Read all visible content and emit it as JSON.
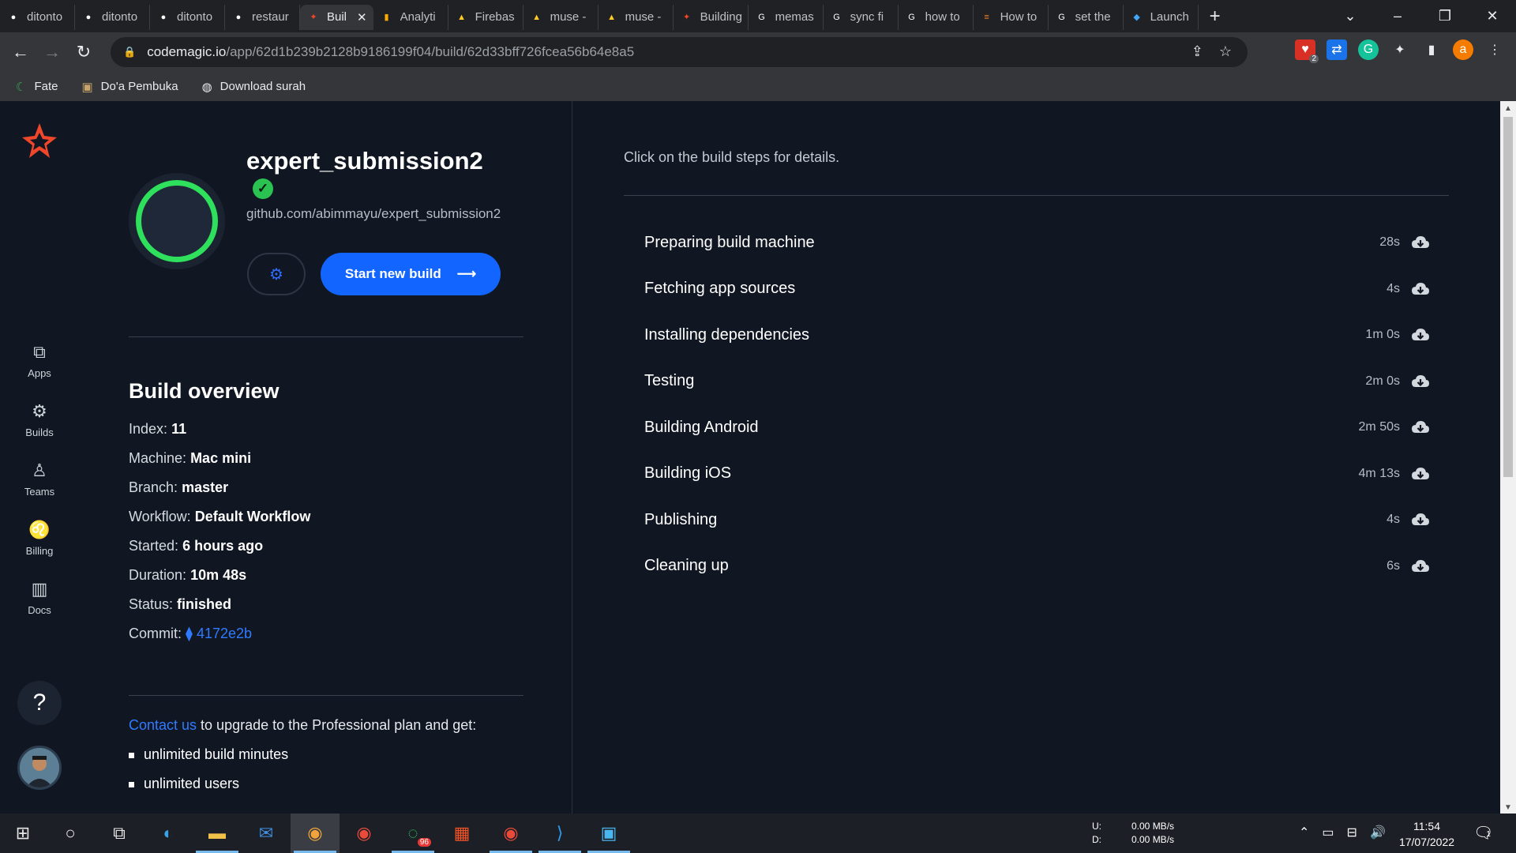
{
  "browser": {
    "tabs": [
      {
        "label": "ditonto",
        "icon": "github-icon"
      },
      {
        "label": "ditonto",
        "icon": "github-icon"
      },
      {
        "label": "ditonto",
        "icon": "github-icon"
      },
      {
        "label": "restaur",
        "icon": "github-icon"
      },
      {
        "label": "Buil",
        "icon": "codemagic-icon",
        "active": true
      },
      {
        "label": "Analyti",
        "icon": "analytics-icon"
      },
      {
        "label": "Firebas",
        "icon": "firebase-icon"
      },
      {
        "label": "muse -",
        "icon": "firebase-icon"
      },
      {
        "label": "muse -",
        "icon": "firebase-icon"
      },
      {
        "label": "Building",
        "icon": "codemagic-icon"
      },
      {
        "label": "memas",
        "icon": "google-icon"
      },
      {
        "label": "sync fi",
        "icon": "google-icon"
      },
      {
        "label": "how to",
        "icon": "google-icon"
      },
      {
        "label": "How to",
        "icon": "stackoverflow-icon"
      },
      {
        "label": "set the",
        "icon": "google-icon"
      },
      {
        "label": "Launch",
        "icon": "flutter-icon"
      }
    ],
    "close_tab_glyph": "✕",
    "new_tab_glyph": "+",
    "url_host": "codemagic.io",
    "url_path": "/app/62d1b239b2128b9186199f04/build/62d33bff726fcea56b64e8a5",
    "bookmarks": [
      {
        "label": "Fate"
      },
      {
        "label": "Do'a Pembuka"
      },
      {
        "label": "Download surah"
      }
    ],
    "ext_badge": "2",
    "profile_letter": "a"
  },
  "sidebar": {
    "items": [
      {
        "label": "Apps",
        "icon": "apps-icon"
      },
      {
        "label": "Builds",
        "icon": "builds-icon"
      },
      {
        "label": "Teams",
        "icon": "teams-icon"
      },
      {
        "label": "Billing",
        "icon": "billing-icon"
      },
      {
        "label": "Docs",
        "icon": "docs-icon"
      }
    ],
    "help_label": "?"
  },
  "app": {
    "name": "expert_submission2",
    "repo": "github.com/abimmayu/expert_submission2",
    "start_build_label": "Start new build",
    "status_color": "#2ee05c",
    "accent_color": "#1265ff"
  },
  "overview": {
    "title": "Build overview",
    "rows": [
      {
        "label": "Index:",
        "value": "11"
      },
      {
        "label": "Machine:",
        "value": "Mac mini"
      },
      {
        "label": "Branch:",
        "value": "master"
      },
      {
        "label": "Workflow:",
        "value": "Default Workflow"
      },
      {
        "label": "Started:",
        "value": "6 hours ago"
      },
      {
        "label": "Duration:",
        "value": "10m 48s"
      },
      {
        "label": "Status:",
        "value": "finished"
      }
    ],
    "commit_label": "Commit:",
    "commit_hash": "4172e2b"
  },
  "promo": {
    "link_text": "Contact us",
    "text": " to upgrade to the Professional plan and get:",
    "bullets": [
      "unlimited build minutes",
      "unlimited users"
    ]
  },
  "steps": {
    "hint": "Click on the build steps for details.",
    "items": [
      {
        "name": "Preparing build machine",
        "duration": "28s"
      },
      {
        "name": "Fetching app sources",
        "duration": "4s"
      },
      {
        "name": "Installing dependencies",
        "duration": "1m 0s"
      },
      {
        "name": "Testing",
        "duration": "2m 0s"
      },
      {
        "name": "Building Android",
        "duration": "2m 50s"
      },
      {
        "name": "Building iOS",
        "duration": "4m 13s"
      },
      {
        "name": "Publishing",
        "duration": "4s"
      },
      {
        "name": "Cleaning up",
        "duration": "6s"
      }
    ]
  },
  "taskbar": {
    "upload_label": "U:",
    "upload_speed": "0.00 MB/s",
    "download_label": "D:",
    "download_speed": "0.00 MB/s",
    "time": "11:54",
    "date": "17/07/2022",
    "whatsapp_badge": "96",
    "notification_count": "1"
  }
}
